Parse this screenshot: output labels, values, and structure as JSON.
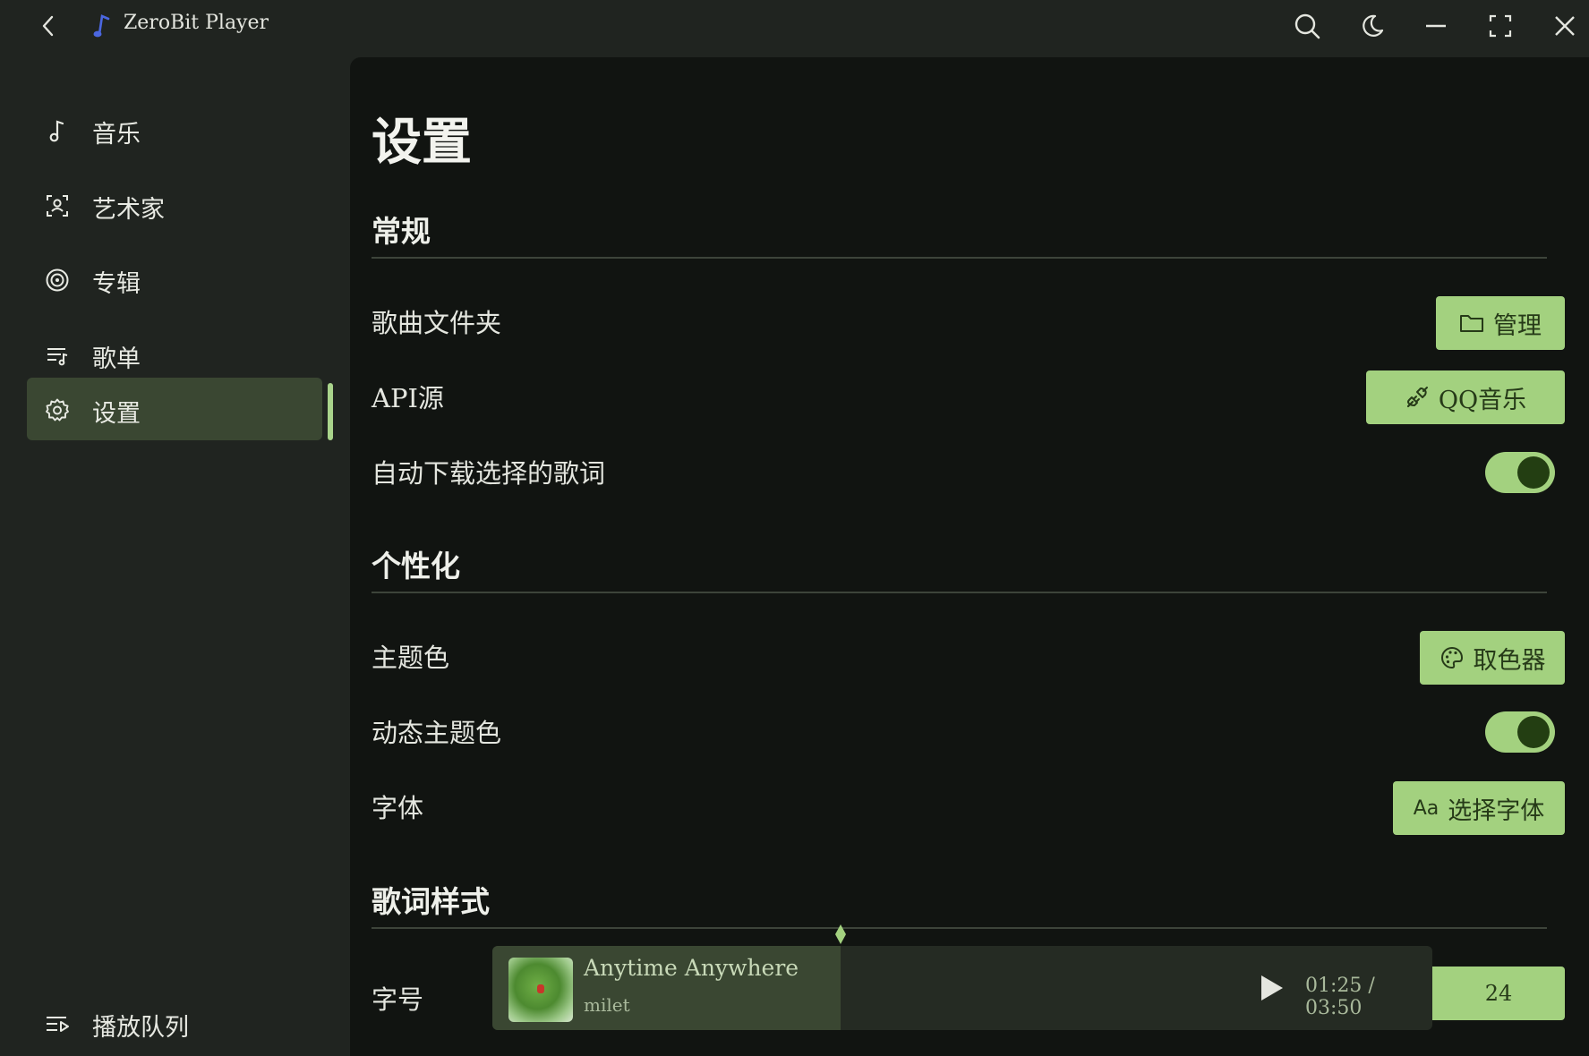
{
  "app": {
    "title": "ZeroBit Player"
  },
  "titlebar": {
    "icons": [
      "back-icon",
      "music-note-logo",
      "search-icon",
      "moon-icon",
      "minimize-icon",
      "fullscreen-icon",
      "close-icon"
    ]
  },
  "sidebar": {
    "items": [
      {
        "label": "音乐",
        "icon": "music-note-icon",
        "active": false
      },
      {
        "label": "艺术家",
        "icon": "artist-icon",
        "active": false
      },
      {
        "label": "专辑",
        "icon": "album-icon",
        "active": false
      },
      {
        "label": "歌单",
        "icon": "playlist-icon",
        "active": false
      },
      {
        "label": "设置",
        "icon": "gear-icon",
        "active": true
      }
    ],
    "queue_label": "播放队列"
  },
  "page": {
    "title": "设置"
  },
  "sections": {
    "general": {
      "title": "常规",
      "folder_label": "歌曲文件夹",
      "folder_button": "管理",
      "api_label": "API源",
      "api_button": "QQ音乐",
      "auto_lyrics_label": "自动下载选择的歌词",
      "auto_lyrics_on": true
    },
    "personalize": {
      "title": "个性化",
      "theme_label": "主题色",
      "theme_button": "取色器",
      "dynamic_theme_label": "动态主题色",
      "dynamic_theme_on": true,
      "font_label": "字体",
      "font_button": "选择字体",
      "font_button_prefix": "Aa"
    },
    "lyrics": {
      "title": "歌词样式",
      "size_label": "字号",
      "size_value": "24"
    }
  },
  "player": {
    "song": "Anytime Anywhere",
    "artist": "milet",
    "current_time": "01:25",
    "separator": "/",
    "total_time": "03:50",
    "progress": 0.37
  },
  "colors": {
    "accent": "#a3d17f",
    "accent_dark": "#233e12",
    "background": "#202420",
    "content_bg": "#111411",
    "active_nav": "#3a4732"
  }
}
